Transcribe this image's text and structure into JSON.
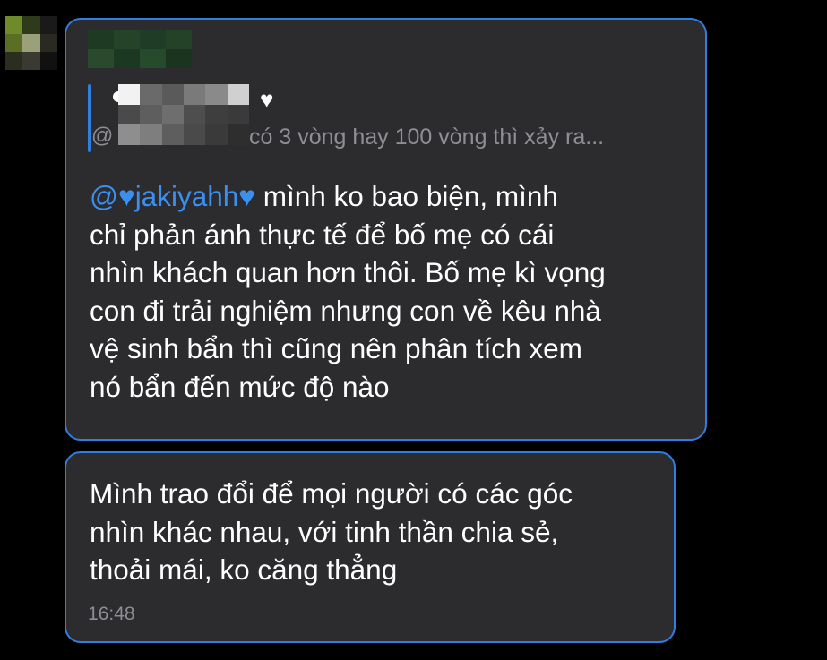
{
  "avatar": {
    "pixels": [
      "#6f8a2a",
      "#2e3a1a",
      "#1a1a1a",
      "#5a6f24",
      "#9aa07a",
      "#2a2a22",
      "#2a2e1e",
      "#3a3a32",
      "#111111"
    ]
  },
  "bubble_1": {
    "sender_pixels": [
      "#1e3a22",
      "#24442a",
      "#1f3d26",
      "#234228",
      "#2a4a2e",
      "#1d3822",
      "#264a2c",
      "#1a3420"
    ],
    "quote": {
      "author_pixels": [
        "#f2f2f2",
        "#6a6a6a",
        "#5a5a5a",
        "#7a7a7a",
        "#8a8a8a",
        "#d0d0d0",
        "#4a4a4a",
        "#5e5e5e",
        "#6e6e6e",
        "#4e4e4e",
        "#3e3e3e",
        "#3a3a3a",
        "#8e8e8e",
        "#7e7e7e",
        "#5e5e5e",
        "#4a4a4a",
        "#3a3a3a",
        "#2e2e2e"
      ],
      "heart": "♥",
      "lead": "@",
      "text": "có 3 vòng hay 100 vòng thì xảy ra..."
    },
    "mention_prefix": "@",
    "mention_heart": "♥",
    "mention_name": "jakiyahh",
    "mention_suffix_heart": "♥",
    "message_body": " mình ko bao biện, mình\nchỉ phản ánh thực tế để bố mẹ có cái\nnhìn khách quan hơn thôi. Bố mẹ kì vọng\ncon đi trải nghiệm nhưng con về kêu nhà\nvệ sinh bẩn thì cũng nên phân tích xem\nnó bẩn đến mức độ nào"
  },
  "bubble_2": {
    "message": "Mình trao đổi để mọi người có các góc\nnhìn khác nhau, với tinh thần chia sẻ,\nthoải mái, ko căng thẳng",
    "timestamp": "16:48"
  },
  "colors": {
    "accent": "#2f7ee0",
    "mention": "#3a8ff0",
    "bubble_bg": "#2c2c2e",
    "muted_text": "#8e8e93"
  }
}
